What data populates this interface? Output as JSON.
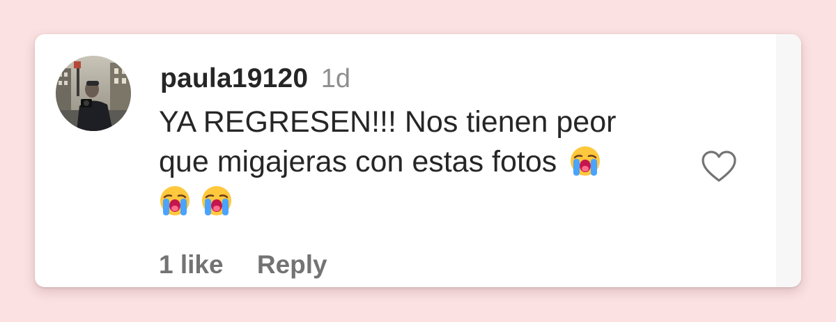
{
  "comment": {
    "username": "paula19120",
    "timestamp": "1d",
    "text_line1": "YA REGRESEN!!! Nos tienen peor",
    "text_line2": "que migajeras con estas fotos",
    "emojis": [
      "loudly-crying-face-emoji",
      "loudly-crying-face-emoji",
      "loudly-crying-face-emoji"
    ],
    "likes_label": "1 like",
    "reply_label": "Reply",
    "like_icon": "heart-outline-icon"
  },
  "colors": {
    "background": "#fbe1e2",
    "card": "#ffffff",
    "text_primary": "#262626",
    "text_secondary": "#8e8e8e",
    "action_text": "#737373"
  }
}
